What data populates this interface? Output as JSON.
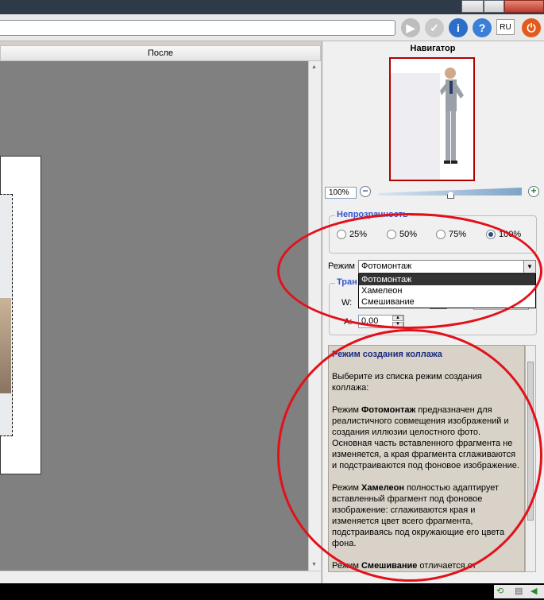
{
  "canvas": {
    "header_label": "После"
  },
  "toolbar": {
    "lang_label": "RU"
  },
  "navigator": {
    "title": "Навигатор",
    "zoom_value": "100%",
    "zoom_level_percent": 50
  },
  "opacity": {
    "legend": "Непрозрачность",
    "options": [
      "25%",
      "50%",
      "75%",
      "100%"
    ],
    "selected": "100%"
  },
  "mode": {
    "label": "Режим",
    "selected": "Фотомонтаж",
    "options": [
      "Фотомонтаж",
      "Хамелеон",
      "Смешивание"
    ]
  },
  "transform": {
    "legend": "Тран",
    "w_label": "W:",
    "a_label": "A:",
    "a_value": "0,00"
  },
  "help": {
    "title": "Режим создания коллажа",
    "intro": "Выберите из списка режим создания коллажа:",
    "p1_pre": "Режим ",
    "p1_bold": "Фотомонтаж",
    "p1_post": " предназначен для реалистичного совмещения изображений и создания иллюзии целостного фото. Основная часть вставленного фрагмента не изменяется, а края фрагмента сглаживаются и подстраиваются под фоновое изображение.",
    "p2_pre": "Режим ",
    "p2_bold": "Хамелеон",
    "p2_post": " полностью адаптирует вставленный фрагмент под фоновое изображение: сглаживаются края и изменяется цвет всего фрагмента, подстраиваясь под окружающие его цвета фона.",
    "p3_pre": "Режим ",
    "p3_bold": "Смешивание",
    "p3_post": " отличается от предыдущего тем, что сквозь вставленный фрагмент просвечивают текстура и пятна"
  },
  "colors": {
    "accent": "#3355cc",
    "annotation": "#e3101a",
    "help_bg": "#d8d2c8"
  }
}
